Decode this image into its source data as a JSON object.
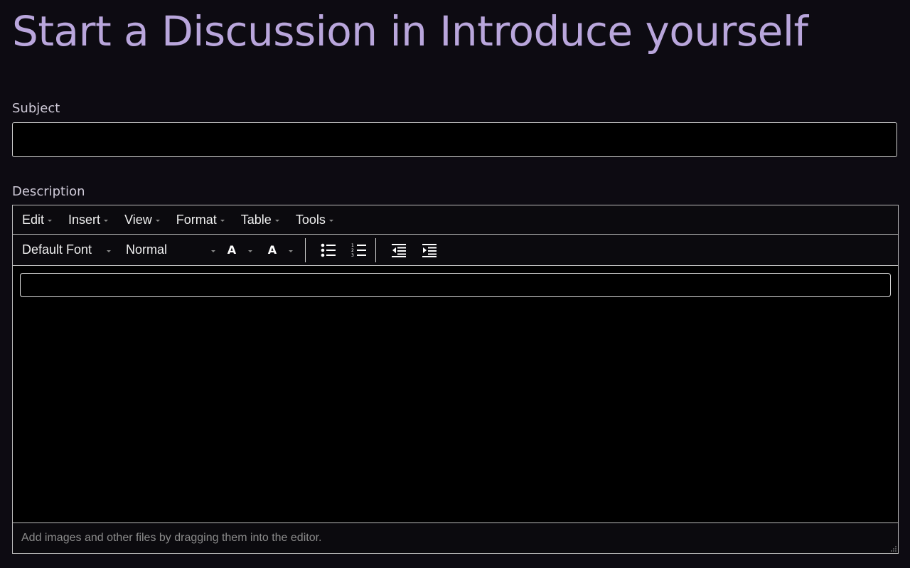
{
  "page": {
    "title": "Start a Discussion in Introduce yourself"
  },
  "form": {
    "subject_label": "Subject",
    "subject_value": "",
    "description_label": "Description"
  },
  "editor": {
    "menu": [
      {
        "label": "Edit"
      },
      {
        "label": "Insert"
      },
      {
        "label": "View"
      },
      {
        "label": "Format"
      },
      {
        "label": "Table"
      },
      {
        "label": "Tools"
      }
    ],
    "toolbar": {
      "font_family": "Default Font",
      "font_size": "Normal",
      "text_color_glyph": "A",
      "background_color_glyph": "A"
    },
    "statusbar_text": "Add images and other files by dragging them into the editor."
  },
  "colors": {
    "accent_title": "#b9a6dc",
    "background": "#0d0b12"
  }
}
